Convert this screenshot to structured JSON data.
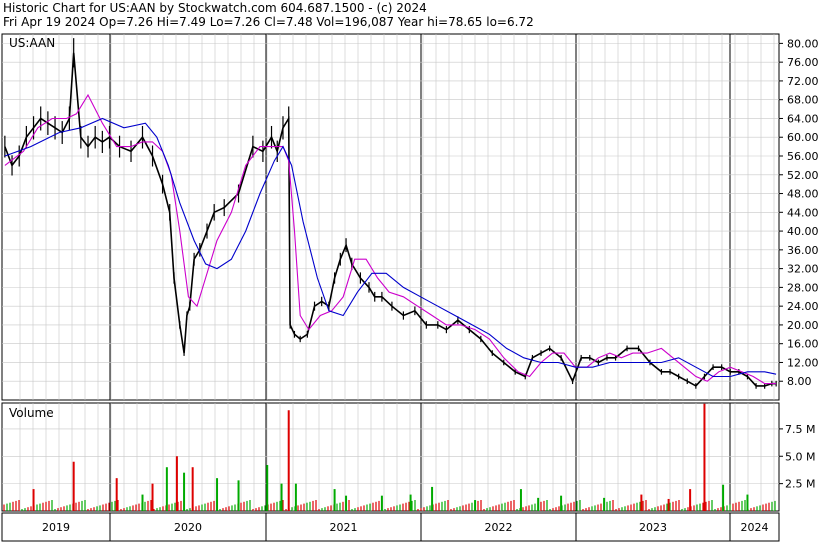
{
  "header": {
    "line1": "Historic Chart for US:AAN by Stockwatch.com 604.687.1500 - (c) 2024",
    "line2": "Fri Apr 19 2024   Op=7.26  Hi=7.49  Lo=7.26  Cl=7.48  Vol=196,087  Year hi=78.65  lo=6.72"
  },
  "price_panel": {
    "symbol": "US:AAN"
  },
  "volume_panel": {
    "title": "Volume"
  },
  "colors": {
    "price_bars": "#000000",
    "short_ma": "#cc00cc",
    "long_ma": "#0000cc",
    "volume_up": "#00aa00",
    "volume_down": "#dd0000",
    "grid": "#c8c8c8"
  },
  "chart_data": [
    {
      "type": "line",
      "title": "US:AAN",
      "ylim": [
        4,
        82
      ],
      "y_ticks": [
        "80.00",
        "76.00",
        "72.00",
        "68.00",
        "64.00",
        "60.00",
        "56.00",
        "52.00",
        "48.00",
        "44.00",
        "40.00",
        "36.00",
        "32.00",
        "28.00",
        "24.00",
        "20.00",
        "16.00",
        "12.00",
        "8.00"
      ],
      "grid": true,
      "x_ticks": [
        "2019",
        "2020",
        "2021",
        "2022",
        "2023",
        "2024"
      ],
      "series": [
        {
          "values_key": "close",
          "x": [
            2018.92,
            2018.97,
            2019.02,
            2019.07,
            2019.12,
            2019.17,
            2019.22,
            2019.27,
            2019.32,
            2019.37,
            2019.4,
            2019.45,
            2019.5,
            2019.55,
            2019.6,
            2019.65,
            2019.72,
            2019.8,
            2019.88,
            2019.95,
            2020.02,
            2020.07,
            2020.1,
            2020.14,
            2020.17,
            2020.19,
            2020.21,
            2020.24,
            2020.28,
            2020.33,
            2020.38,
            2020.45,
            2020.55,
            2020.65,
            2020.72,
            2020.78,
            2020.82,
            2020.86,
            2020.9,
            2020.91,
            2020.94,
            2020.98,
            2021.03,
            2021.08,
            2021.13,
            2021.18,
            2021.22,
            2021.26,
            2021.3,
            2021.34,
            2021.4,
            2021.46,
            2021.5,
            2021.55,
            2021.62,
            2021.7,
            2021.78,
            2021.86,
            2021.94,
            2022.0,
            2022.08,
            2022.16,
            2022.24,
            2022.32,
            2022.4,
            2022.48,
            2022.55,
            2022.6,
            2022.66,
            2022.72,
            2022.8,
            2022.88,
            2022.94,
            2023.0,
            2023.06,
            2023.12,
            2023.18,
            2023.26,
            2023.34,
            2023.42,
            2023.5,
            2023.56,
            2023.62,
            2023.68,
            2023.74,
            2023.8,
            2023.86,
            2023.92,
            2023.98,
            2024.04,
            2024.1,
            2024.16,
            2024.22,
            2024.27,
            2024.3
          ],
          "y": [
            58,
            54,
            56,
            60,
            62,
            64,
            63,
            62,
            61,
            64,
            78,
            60,
            58,
            60,
            59,
            60,
            58,
            57,
            60,
            56,
            50,
            44,
            30,
            20,
            14,
            22,
            24,
            34,
            36,
            40,
            44,
            45,
            48,
            58,
            57,
            60,
            57,
            62,
            64,
            20,
            18,
            17,
            18,
            24,
            25,
            24,
            30,
            34,
            37,
            33,
            30,
            28,
            26,
            26,
            24,
            22,
            23,
            20,
            20,
            19,
            21,
            19,
            17,
            14,
            12,
            10,
            9,
            13,
            14,
            15,
            13,
            8,
            13,
            13,
            12,
            13,
            13,
            15,
            15,
            12,
            10,
            10,
            9,
            8,
            7,
            9,
            11,
            11,
            10,
            10,
            9,
            7,
            7,
            7.5,
            7.48
          ]
        },
        {
          "name": "",
          "values_key": "ma_short",
          "x": [
            2018.92,
            2019.05,
            2019.15,
            2019.25,
            2019.35,
            2019.42,
            2019.5,
            2019.6,
            2019.7,
            2019.8,
            2019.88,
            2019.95,
            2020.02,
            2020.08,
            2020.14,
            2020.2,
            2020.26,
            2020.32,
            2020.4,
            2020.5,
            2020.6,
            2020.7,
            2020.8,
            2020.86,
            2020.9,
            2020.94,
            2020.98,
            2021.04,
            2021.12,
            2021.2,
            2021.28,
            2021.36,
            2021.44,
            2021.52,
            2021.6,
            2021.7,
            2021.8,
            2021.9,
            2022.0,
            2022.1,
            2022.2,
            2022.3,
            2022.4,
            2022.5,
            2022.58,
            2022.66,
            2022.74,
            2022.82,
            2022.9,
            2022.98,
            2023.06,
            2023.14,
            2023.22,
            2023.3,
            2023.4,
            2023.5,
            2023.58,
            2023.66,
            2023.74,
            2023.82,
            2023.9,
            2023.98,
            2024.06,
            2024.14,
            2024.22,
            2024.3
          ],
          "y": [
            54,
            57,
            62,
            64,
            64,
            65,
            69,
            63,
            58,
            58,
            59,
            59,
            57,
            52,
            40,
            26,
            24,
            30,
            38,
            44,
            54,
            58,
            58,
            58,
            55,
            40,
            22,
            19,
            22,
            23,
            26,
            34,
            34,
            30,
            27,
            26,
            24,
            22,
            20,
            20,
            19,
            17,
            13,
            10,
            9,
            12,
            14,
            14,
            11,
            11,
            13,
            14,
            13,
            14,
            14,
            15,
            13,
            11,
            9,
            8,
            10,
            11,
            10,
            9,
            7.5,
            7.5
          ]
        },
        {
          "name": "",
          "values_key": "ma_long",
          "x": [
            2018.92,
            2019.1,
            2019.3,
            2019.45,
            2019.6,
            2019.75,
            2019.9,
            2019.98,
            2020.06,
            2020.14,
            2020.24,
            2020.32,
            2020.4,
            2020.5,
            2020.6,
            2020.7,
            2020.8,
            2020.86,
            2020.92,
            2021.0,
            2021.1,
            2021.18,
            2021.28,
            2021.38,
            2021.48,
            2021.58,
            2021.7,
            2021.82,
            2021.94,
            2022.06,
            2022.18,
            2022.3,
            2022.42,
            2022.54,
            2022.66,
            2022.78,
            2022.9,
            2023.02,
            2023.14,
            2023.26,
            2023.38,
            2023.5,
            2023.62,
            2023.74,
            2023.86,
            2023.98,
            2024.1,
            2024.22,
            2024.3
          ],
          "y": [
            56,
            58,
            61,
            62,
            64,
            62,
            63,
            60,
            54,
            46,
            38,
            33,
            32,
            34,
            40,
            48,
            55,
            58,
            54,
            42,
            30,
            23,
            22,
            27,
            31,
            31,
            28,
            26,
            24,
            22,
            20,
            18,
            15,
            13,
            12,
            12,
            11,
            11,
            12,
            12,
            12,
            12,
            13,
            11,
            9,
            9,
            10,
            10,
            9.5
          ]
        }
      ]
    },
    {
      "type": "bar",
      "title": "Volume",
      "y_ticks": [
        "7.5 M",
        "5.0 M",
        "2.5 M"
      ],
      "ylim": [
        0,
        9.5
      ],
      "x": [
        2019.12,
        2019.4,
        2019.7,
        2019.88,
        2019.95,
        2020.05,
        2020.12,
        2020.17,
        2020.23,
        2020.4,
        2020.55,
        2020.75,
        2020.85,
        2020.9,
        2020.95,
        2021.22,
        2021.3,
        2021.55,
        2021.75,
        2021.9,
        2022.2,
        2022.52,
        2022.64,
        2022.8,
        2023.1,
        2023.36,
        2023.55,
        2023.7,
        2023.8,
        2023.93,
        2024.1
      ],
      "values": [
        2.0,
        4.5,
        3.0,
        1.5,
        2.5,
        4.0,
        5.0,
        3.5,
        4.0,
        3.0,
        2.8,
        4.2,
        2.5,
        9.2,
        2.5,
        2.0,
        1.4,
        1.4,
        1.5,
        2.2,
        1.0,
        2.0,
        1.2,
        1.4,
        1.2,
        1.5,
        1.1,
        2.0,
        9.8,
        2.4,
        1.5
      ],
      "colors": [
        "down",
        "down",
        "down",
        "up",
        "down",
        "up",
        "down",
        "up",
        "down",
        "up",
        "up",
        "up",
        "up",
        "down",
        "up",
        "up",
        "up",
        "up",
        "up",
        "up",
        "up",
        "up",
        "up",
        "up",
        "up",
        "down",
        "down",
        "down",
        "down",
        "up",
        "up"
      ]
    }
  ]
}
